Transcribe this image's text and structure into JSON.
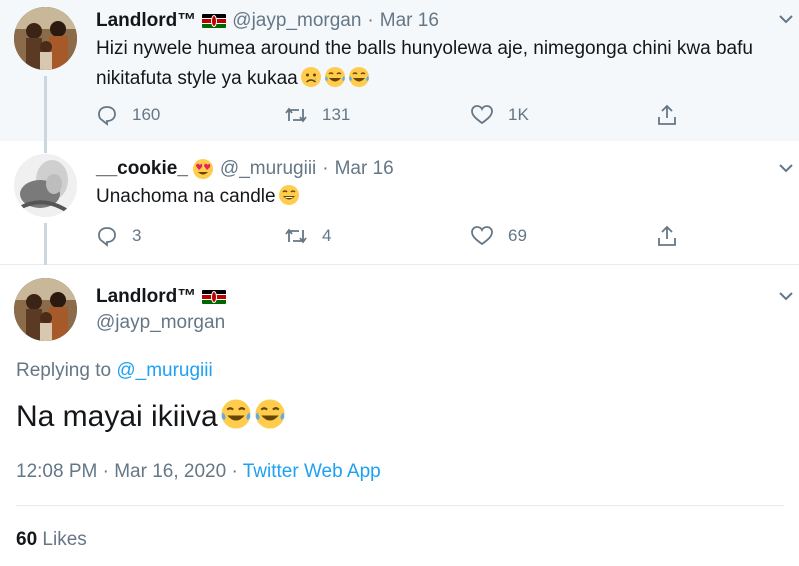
{
  "colors": {
    "accent": "#1da1f2",
    "muted": "#657786",
    "highlight_bg": "#f5f8fa",
    "thread_line": "#ccd6dd"
  },
  "tweets": [
    {
      "display_name": "Landlord™",
      "flag_icon": "kenya-flag",
      "handle": "@jayp_morgan",
      "separator": "·",
      "date": "Mar 16",
      "text": "Hizi nywele humea around the balls hunyolewa aje, nimegonga chini kwa bafu nikitafuta style ya kukaa",
      "emojis": [
        "worried-face-emoji",
        "tears-of-joy-emoji",
        "tears-of-joy-emoji"
      ],
      "reply_count": "160",
      "retweet_count": "131",
      "like_count": "1K"
    },
    {
      "display_name": "__cookie_",
      "name_emoji": "heart-eyes-emoji",
      "handle": "@_murugiii",
      "separator": "·",
      "date": "Mar 16",
      "text": "Unachoma na candle",
      "emojis": [
        "grinning-face-emoji"
      ],
      "reply_count": "3",
      "retweet_count": "4",
      "like_count": "69"
    }
  ],
  "main_tweet": {
    "display_name": "Landlord™",
    "flag_icon": "kenya-flag",
    "handle": "@jayp_morgan",
    "replying_prefix": "Replying to",
    "replying_handle": "@_murugiii",
    "text": "Na mayai ikiiva",
    "emojis": [
      "tears-of-joy-emoji",
      "tears-of-joy-emoji"
    ],
    "time": "12:08 PM",
    "separator": "·",
    "date": "Mar 16, 2020",
    "source": "Twitter Web App",
    "likes_count": "60",
    "likes_label": "Likes"
  }
}
